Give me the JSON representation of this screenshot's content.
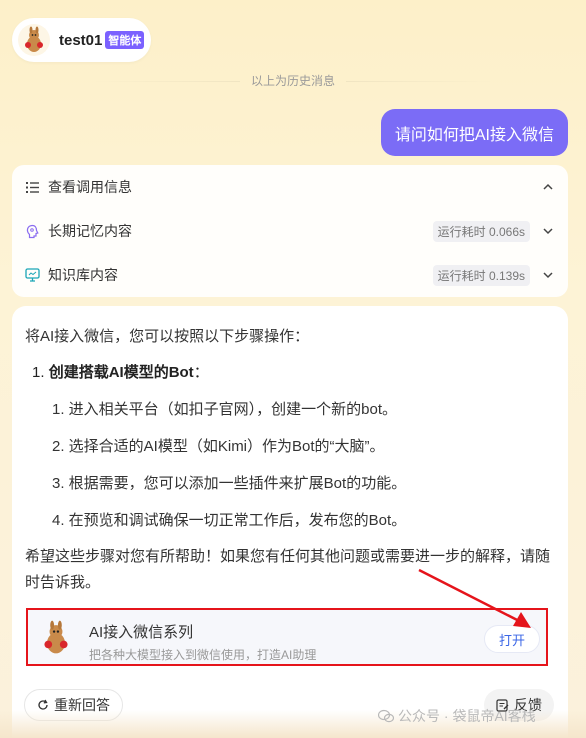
{
  "header": {
    "bot_name": "test01",
    "bot_badge": "智能体"
  },
  "history_label": "以上为历史消息",
  "user_message": "请问如何把AI接入微信",
  "info": {
    "title": "查看调用信息",
    "rows": [
      {
        "label": "长期记忆内容",
        "time": "运行耗时 0.066s",
        "icon": "brain-icon"
      },
      {
        "label": "知识库内容",
        "time": "运行耗时 0.139s",
        "icon": "monitor-icon"
      }
    ]
  },
  "answer": {
    "intro": "将AI接入微信，您可以按照以下步骤操作：",
    "step_number": "1.",
    "step_title": "创建搭载AI模型的Bot",
    "step_colon": "：",
    "substeps": [
      "1. 进入相关平台（如扣子官网），创建一个新的bot。",
      "2. 选择合适的AI模型（如Kimi）作为Bot的“大脑”。",
      "3. 根据需要，您可以添加一些插件来扩展Bot的功能。",
      "4. 在预览和调试确保一切正常工作后，发布您的Bot。"
    ],
    "closing": "希望这些步骤对您有所帮助！如果您有任何其他问题或需要进一步的解释，请随时告诉我。"
  },
  "plugin": {
    "title": "AI接入微信系列",
    "desc": "把各种大模型接入到微信使用，打造AI助理",
    "open_label": "打开"
  },
  "actions": {
    "regen_label": "重新回答",
    "feedback_label": "反馈"
  },
  "watermark": "公众号 · 袋鼠帝AI客栈",
  "colors": {
    "accent": "#7b6cf6",
    "badge": "#7b61ff",
    "highlight": "#e5141b",
    "link": "#3a66e6"
  }
}
